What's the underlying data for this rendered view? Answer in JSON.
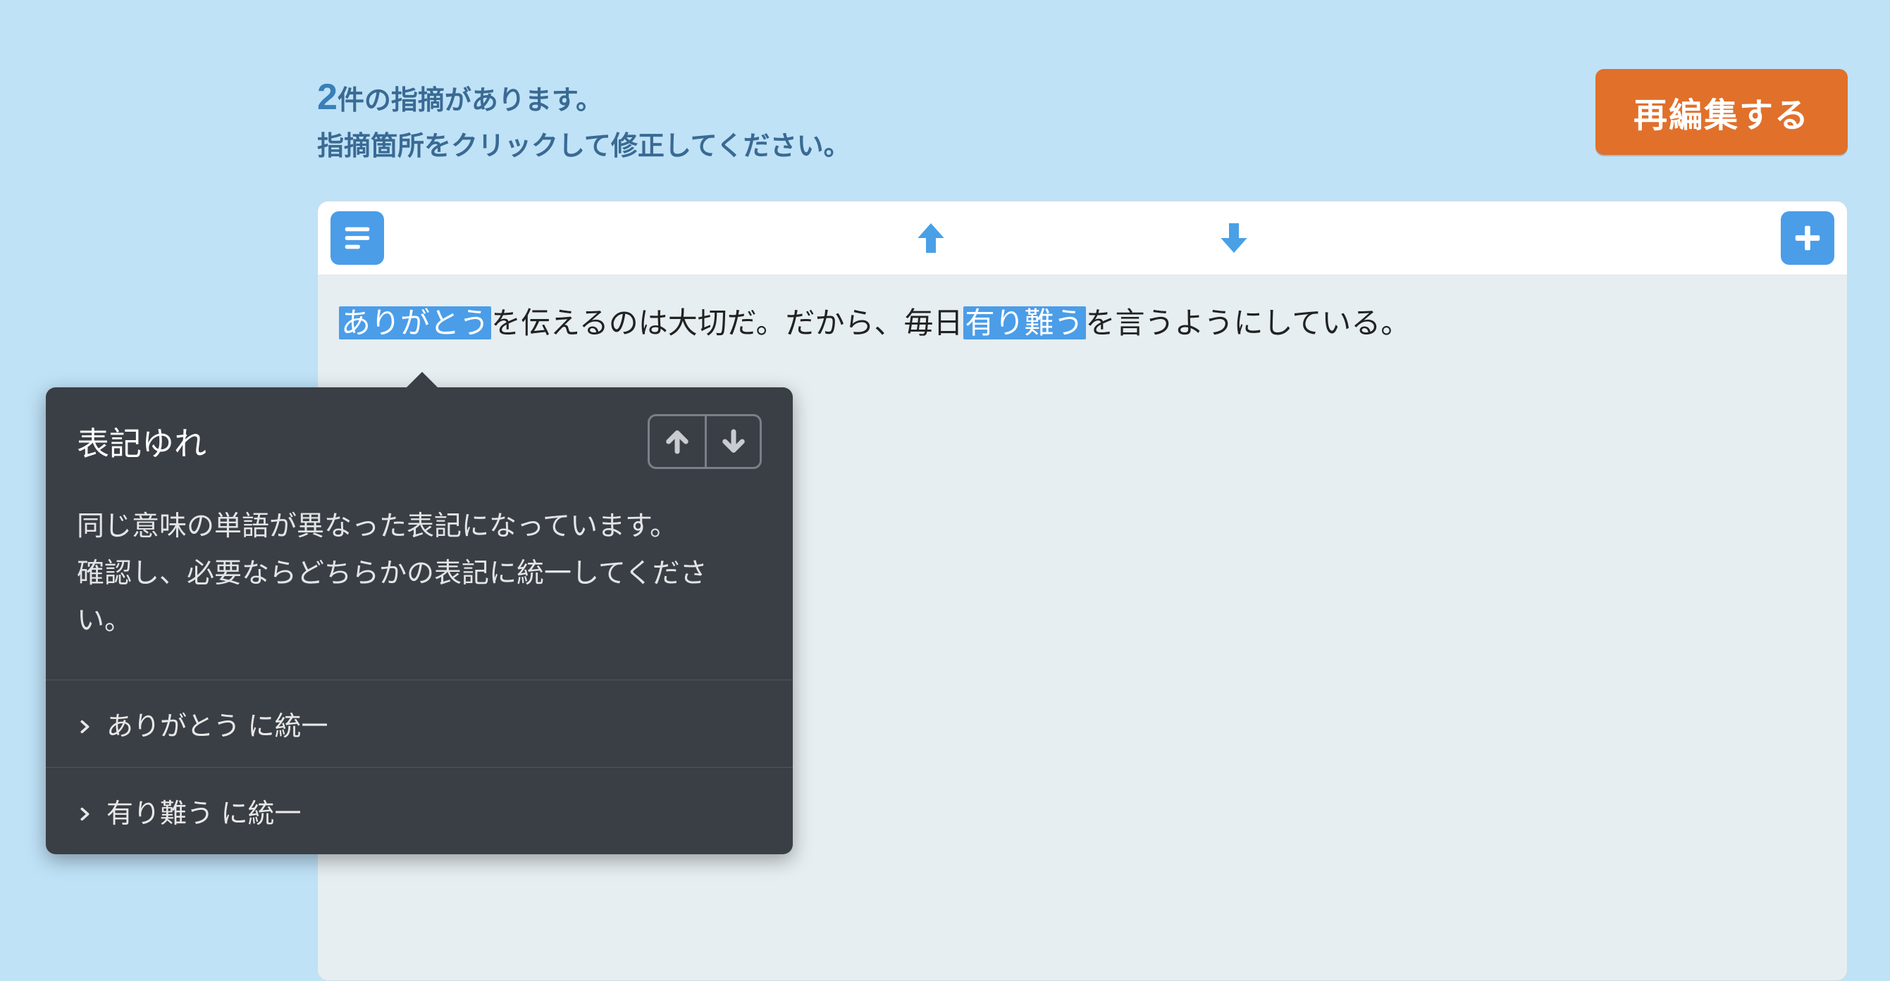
{
  "header": {
    "count": "2",
    "count_suffix": "件の指摘があります。",
    "instruction": "指摘箇所をクリックして修正してください。",
    "reedit_label": "再編集する"
  },
  "editor": {
    "text_parts": {
      "h1": "ありがとう",
      "t1": "を伝えるのは大切だ。だから、毎日",
      "h2": "有り難う",
      "t2": "を言うようにしている。"
    }
  },
  "tooltip": {
    "title": "表記ゆれ",
    "description": "同じ意味の単語が異なった表記になっています。\n確認し、必要ならどちらかの表記に統一してください。",
    "actions": [
      "ありがとう に統一",
      "有り難う に統一"
    ]
  }
}
